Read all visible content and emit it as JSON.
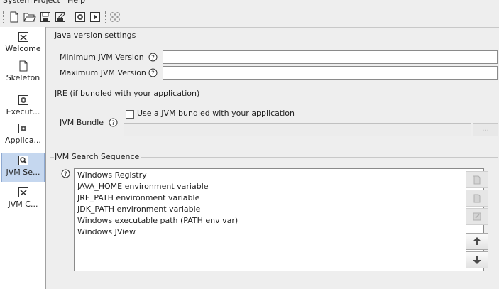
{
  "menu": {
    "items": [
      "System",
      "Project",
      "Help"
    ]
  },
  "toolbar": {
    "buttons": [
      {
        "icon": "new-document-icon"
      },
      {
        "icon": "open-folder-icon"
      },
      {
        "icon": "save-icon"
      },
      {
        "icon": "save-as-icon"
      },
      {
        "icon": "build-icon"
      },
      {
        "icon": "run-icon"
      },
      {
        "icon": "grid-icon"
      }
    ]
  },
  "sidebar": {
    "items": [
      {
        "label": "Welcome",
        "icon": "welcome-icon"
      },
      {
        "label": "Skeleton",
        "icon": "skeleton-icon"
      },
      {
        "label": "Execut...",
        "icon": "executable-icon"
      },
      {
        "label": "Applica...",
        "icon": "application-icon"
      },
      {
        "label": "JVM Se...",
        "icon": "jvm-search-icon",
        "selected": true
      },
      {
        "label": "JVM C...",
        "icon": "jvm-config-icon"
      }
    ]
  },
  "java_version": {
    "title": "Java version settings",
    "min_label": "Minimum JVM Version",
    "min_value": "",
    "max_label": "Maximum JVM Version",
    "max_value": ""
  },
  "jre": {
    "title": "JRE (if bundled with your application)",
    "bundle_label": "JVM Bundle",
    "checkbox_label": "Use a JVM bundled with your application",
    "checkbox_checked": false,
    "path_value": "",
    "browse_label": "..."
  },
  "search": {
    "title": "JVM Search Sequence",
    "items": [
      "Windows Registry",
      "JAVA_HOME environment variable",
      "JRE_PATH environment variable",
      "JDK_PATH environment variable",
      "Windows executable path (PATH env var)",
      "Windows JView"
    ]
  }
}
